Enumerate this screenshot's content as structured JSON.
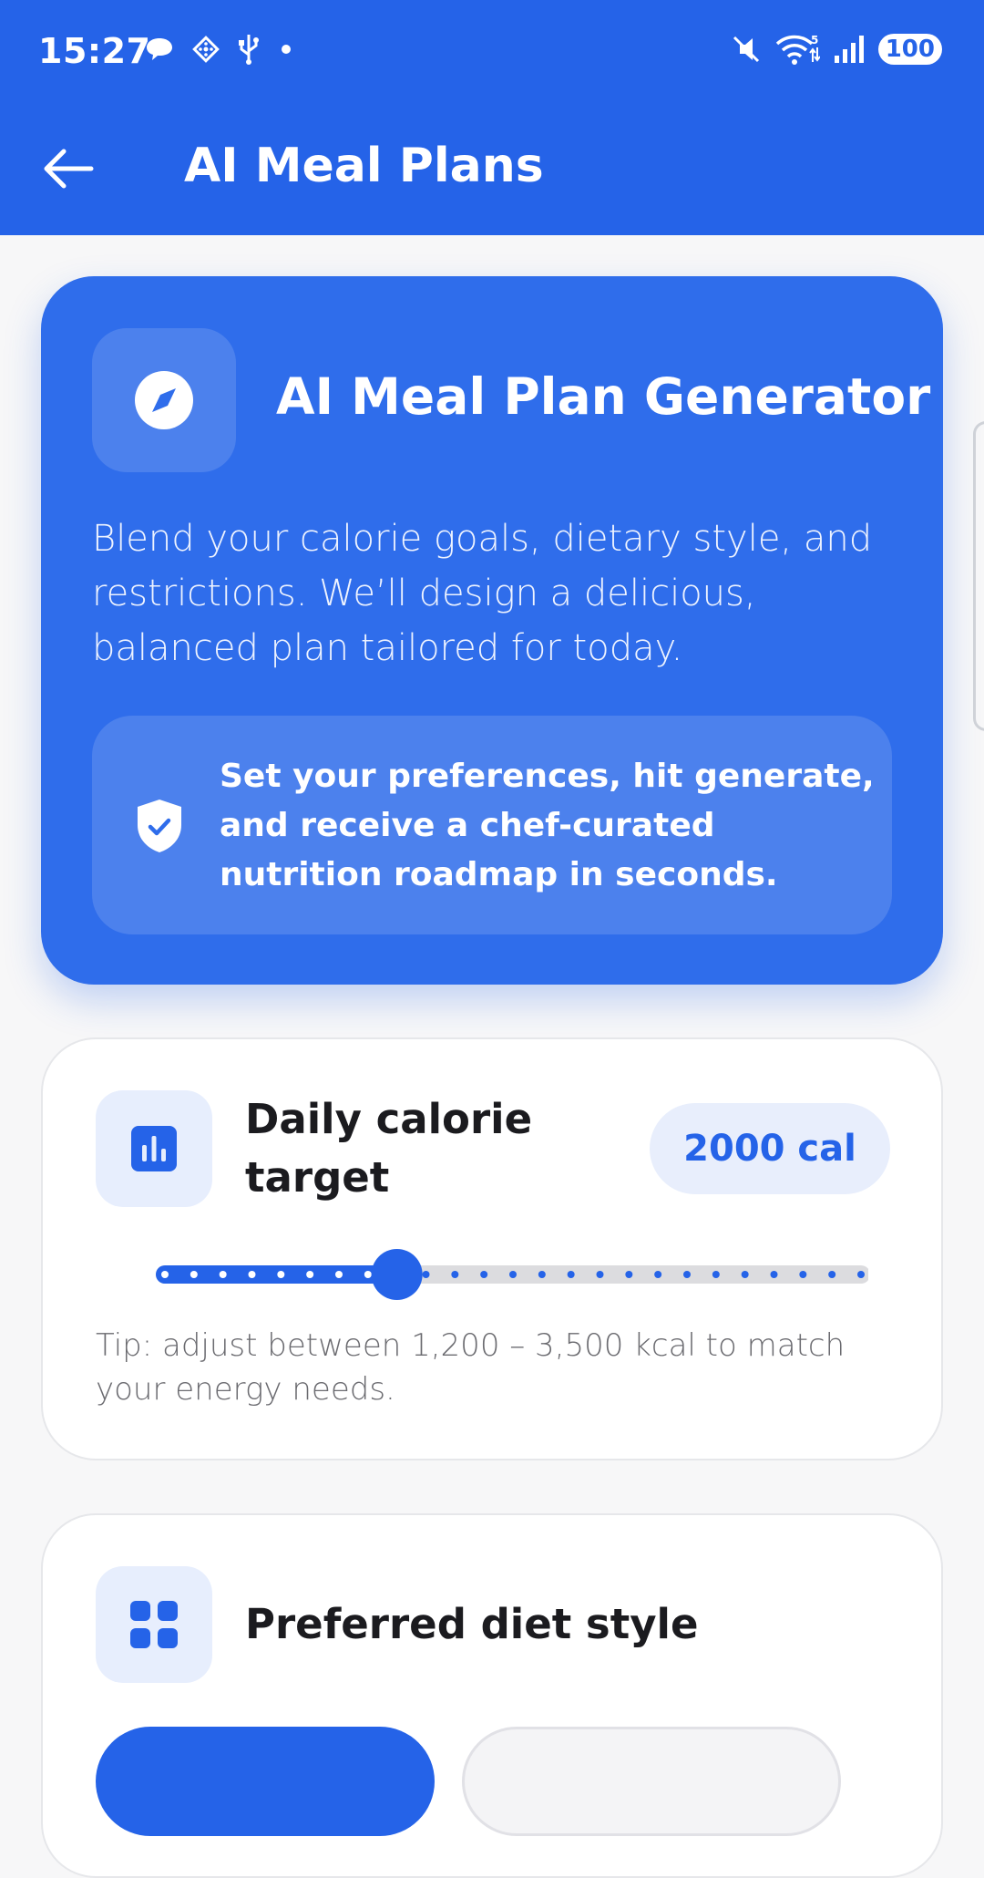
{
  "status_bar": {
    "time": "15:27",
    "left_icons": [
      "chat-bubble-icon",
      "diamond-app-icon",
      "usb-icon",
      "dot-icon"
    ],
    "right_icons": [
      "mute-icon",
      "wifi-icon",
      "signal-icon"
    ],
    "battery": "100"
  },
  "app_bar": {
    "title": "AI Meal Plans",
    "back_icon": "arrow-left-icon"
  },
  "hero": {
    "icon": "compass-icon",
    "title": "AI Meal Plan Generator",
    "description": "Blend your calorie goals, dietary style, and restrictions. We’ll design a delicious, balanced plan tailored for today.",
    "note_icon": "shield-check-icon",
    "note": "Set your preferences, hit generate, and receive a chef-curated nutrition roadmap in seconds."
  },
  "calorie_card": {
    "icon": "bar-chart-icon",
    "title": "Daily calorie target",
    "value_label": "2000 cal",
    "slider": {
      "min": 1200,
      "max": 3500,
      "value": 2000,
      "step_count": 24,
      "selected_step": 8
    },
    "tip": "Tip: adjust between 1,200 – 3,500 kcal to match your energy needs."
  },
  "diet_card": {
    "icon": "grid-icon",
    "title": "Preferred diet style"
  },
  "colors": {
    "primary": "#2563e8",
    "hero_bg": "#2f6deb",
    "track_inactive": "#dcdcdf",
    "background": "#f7f7f8"
  }
}
